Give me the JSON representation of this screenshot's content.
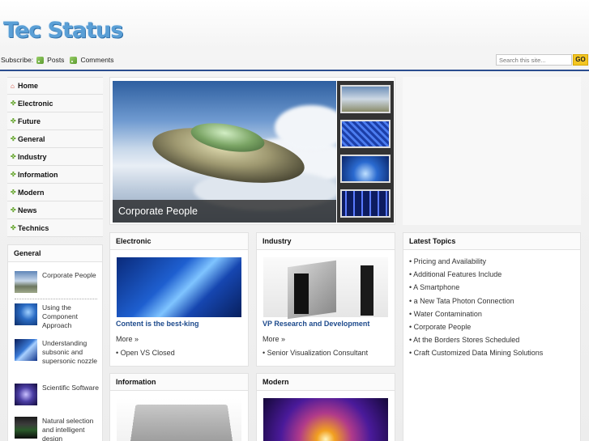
{
  "header": {
    "logo": "Tec Status",
    "subscribe_label": "Subscribe:",
    "posts_label": "Posts",
    "comments_label": "Comments",
    "search_placeholder": "Search this site...",
    "go_label": "GO"
  },
  "nav": [
    {
      "label": "Home",
      "icon": "home-icon"
    },
    {
      "label": "Electronic",
      "icon": "arrow-icon"
    },
    {
      "label": "Future",
      "icon": "arrow-icon"
    },
    {
      "label": "General",
      "icon": "arrow-icon"
    },
    {
      "label": "Industry",
      "icon": "arrow-icon"
    },
    {
      "label": "Information",
      "icon": "arrow-icon"
    },
    {
      "label": "Modern",
      "icon": "arrow-icon"
    },
    {
      "label": "News",
      "icon": "arrow-icon"
    },
    {
      "label": "Technics",
      "icon": "arrow-icon"
    }
  ],
  "sidebar_general": {
    "title": "General",
    "posts": [
      {
        "title": "Corporate People"
      },
      {
        "title": "Using the Component Approach"
      },
      {
        "title": "Understanding subsonic and supersonic nozzle"
      },
      {
        "title": "Scientific Software"
      },
      {
        "title": "Natural selection and intelligent design"
      }
    ]
  },
  "slider": {
    "caption": "Corporate People"
  },
  "boxes": {
    "electronic": {
      "title": "Electronic",
      "feature": "Content is the best-king",
      "more": "More »",
      "link": "Open VS Closed"
    },
    "industry": {
      "title": "Industry",
      "feature": "VP Research and Development",
      "more": "More »",
      "link": "Senior Visualization Consultant"
    },
    "information": {
      "title": "Information"
    },
    "modern": {
      "title": "Modern"
    }
  },
  "latest_topics": {
    "title": "Latest Topics",
    "items": [
      "Pricing and Availability",
      "Additional Features Include",
      "A Smartphone",
      "a New Tata Photon Connection",
      "Water Contamination",
      "Corporate People",
      "At the Borders Stores Scheduled",
      "Craft Customized Data Mining Solutions"
    ]
  },
  "colors": {
    "logo": "#5a9fd6",
    "header_rule": "#2b4d8f",
    "link_blue": "#1d4a8c",
    "nav_arrow": "#6aa834",
    "go_button": "#f3c623"
  }
}
